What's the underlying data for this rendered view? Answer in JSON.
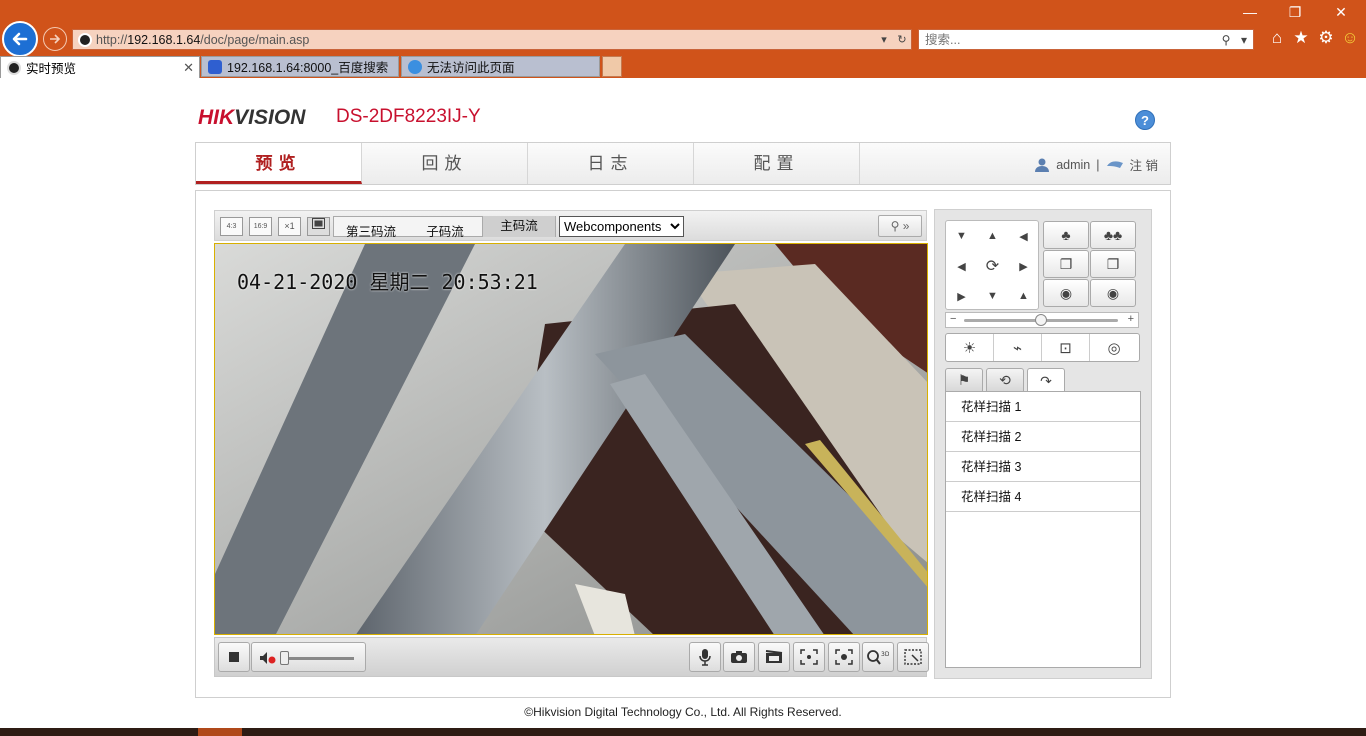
{
  "browser": {
    "url_prefix": "http://",
    "url_host": "192.168.1.64",
    "url_path": "/doc/page/main.asp",
    "search_placeholder": "搜索...",
    "tabs": [
      {
        "label": "实时预览",
        "active": true
      },
      {
        "label": "192.168.1.64:8000_百度搜索",
        "active": false
      },
      {
        "label": "无法访问此页面",
        "active": false
      }
    ],
    "window_controls": {
      "minimize": "—",
      "restore": "❐",
      "close": "✕"
    }
  },
  "app": {
    "logo_red": "HIK",
    "logo_grey": "VISION",
    "model": "DS-2DF8223IJ-Y",
    "help": "?",
    "nav": [
      {
        "label": "预览",
        "active": true
      },
      {
        "label": "回放",
        "active": false
      },
      {
        "label": "日志",
        "active": false
      },
      {
        "label": "配置",
        "active": false
      }
    ],
    "user": "admin",
    "separator": "|",
    "logout": "注 销",
    "colors": {
      "accent": "#b02020",
      "logo": "#c8102e",
      "browser": "#d0531a"
    }
  },
  "video": {
    "ratios": [
      "4:3",
      "16:9",
      "×1"
    ],
    "streams": [
      {
        "label": "第三码流",
        "active": false
      },
      {
        "label": "子码流",
        "active": false
      },
      {
        "label": "主码流",
        "active": true
      }
    ],
    "plugin": "Webcomponents",
    "plugin_options": [
      "Webcomponents"
    ],
    "more": "»",
    "osd_datetime": "04-21-2020 星期二 20:53:21",
    "volume": 0
  },
  "ptz": {
    "zoom_level": 0.5,
    "patterns": [
      "花样扫描 1",
      "花样扫描 2",
      "花样扫描 3",
      "花样扫描 4"
    ]
  },
  "footer": "©Hikvision Digital Technology Co., Ltd. All Rights Reserved."
}
